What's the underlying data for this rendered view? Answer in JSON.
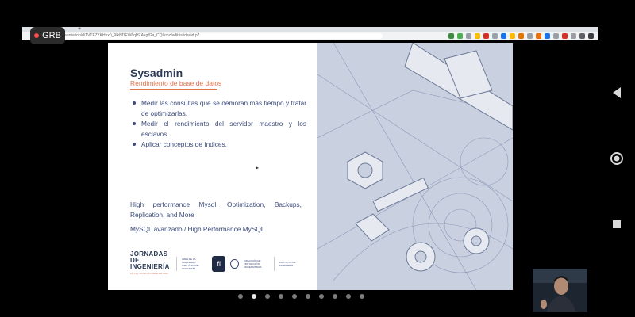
{
  "recording": {
    "label": "GRB"
  },
  "browser": {
    "new_tab": "+",
    "url": ".com/presentation/d/1VTF7YKHnx0_9IkNDEW6qHZAkgfGa_CQIkmz/edit#slide=id.p7"
  },
  "slide": {
    "title": "Sysadmin",
    "subtitle": "Rendimiento de base de datos",
    "bullets": [
      "Medir las consultas que se demoran más tiempo y tratar de optimizarlas.",
      "Medir el rendimiento del servidor maestro y los esclavos.",
      "Aplicar conceptos de índices."
    ],
    "reference_1": "High performance Mysql: Optimization, Backups, Replication, and More",
    "reference_2": "MySQL avanzado / High Performance MySQL",
    "footer": {
      "event_title_1": "JORNADAS DE",
      "event_title_2": "INGENIERÍA",
      "event_dates": "10, 11 y 12 DE OCTUBRE DE 2022",
      "faculty": "ÁREA DE LA INGENIERÍA CIENTÍFICA DE INGENIERÍA",
      "fi_logo": "fi",
      "division": "DIRECCIÓN DE PROYECCIÓN UNIVERSITARIA",
      "institute": "INSTITUTO DE INGENIERÍA"
    }
  },
  "nav": {
    "count": 10,
    "active_index": 1
  },
  "colors": {
    "title": "#2b3a55",
    "accent": "#e0734a",
    "body_text": "#3b4a78",
    "background": "#000000"
  }
}
